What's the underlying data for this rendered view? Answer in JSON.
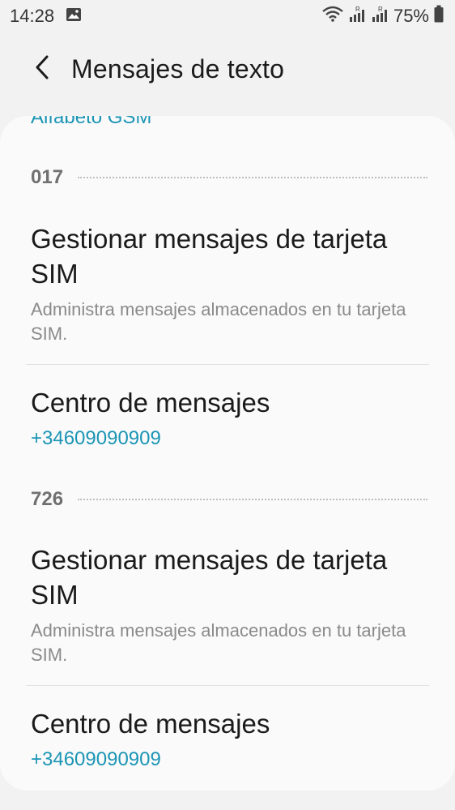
{
  "status_bar": {
    "time": "14:28",
    "battery": "75%",
    "icons": [
      "image-icon",
      "wifi-icon",
      "signal-icon-sim1",
      "signal-icon-sim2",
      "battery-icon"
    ]
  },
  "app_bar": {
    "title": "Mensajes de texto",
    "back_icon": "back-arrow-icon"
  },
  "clipped_item": {
    "text": "Alfabeto GSM"
  },
  "sections": [
    {
      "label": "017",
      "items": [
        {
          "title": "Gestionar mensajes de tarjeta SIM",
          "summary": "Administra mensajes almacenados en tu tarjeta SIM."
        },
        {
          "title": "Centro de mensajes",
          "value": "+34609090909"
        }
      ]
    },
    {
      "label": "726",
      "items": [
        {
          "title": "Gestionar mensajes de tarjeta SIM",
          "summary": "Administra mensajes almacenados en tu tarjeta SIM."
        },
        {
          "title": "Centro de mensajes",
          "value": "+34609090909"
        }
      ]
    }
  ],
  "colors": {
    "accent": "#1c95b5",
    "background": "#f2f2f2",
    "card": "#fafafa"
  }
}
